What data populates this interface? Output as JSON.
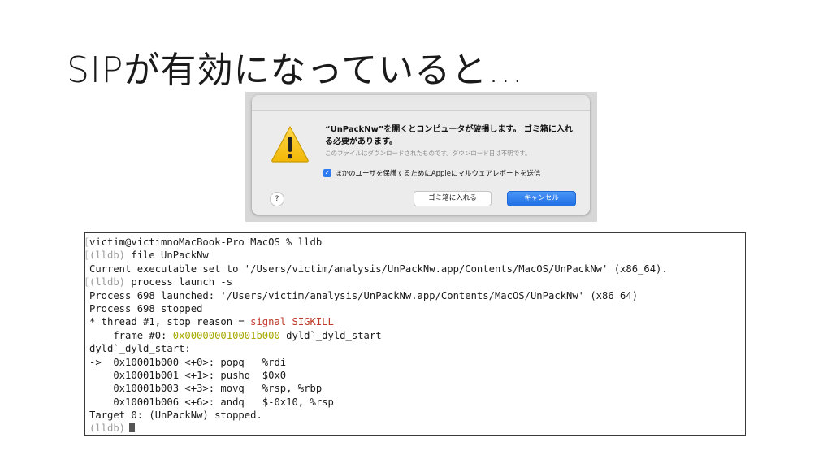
{
  "slide": {
    "title": "SIPが有効になっていると…"
  },
  "dialog": {
    "message": "“UnPackNw”を開くとコンピュータが破損します。 ゴミ箱に入れる必要があります。",
    "info": "このファイルはダウンロードされたものです。ダウンロード日は不明です。",
    "checkbox_label": "ほかのユーザを保護するためにAppleにマルウェアレポートを送信",
    "checkbox_checked": true,
    "help_label": "?",
    "trash_button": "ゴミ箱に入れる",
    "cancel_button": "キャンセル",
    "warning_icon": "warning-triangle-icon",
    "accent_color": "#2d7bf0"
  },
  "terminal": {
    "colors": {
      "signal": "#c0392b",
      "address": "#a8a800",
      "prompt": "#9a9a9a"
    },
    "lines": [
      {
        "bracket": "[",
        "segments": [
          {
            "text": "victim@victimnoMacBook-Pro MacOS % lldb",
            "style": "normal"
          }
        ]
      },
      {
        "bracket": "[",
        "segments": [
          {
            "text": "(lldb)",
            "style": "dim"
          },
          {
            "text": " file UnPackNw",
            "style": "normal"
          }
        ]
      },
      {
        "bracket": "",
        "segments": [
          {
            "text": "Current executable set to '/Users/victim/analysis/UnPackNw.app/Contents/MacOS/UnPackNw' (x86_64).",
            "style": "normal"
          }
        ]
      },
      {
        "bracket": "[",
        "segments": [
          {
            "text": "(lldb)",
            "style": "dim"
          },
          {
            "text": " process launch -s",
            "style": "normal"
          }
        ]
      },
      {
        "bracket": "",
        "segments": [
          {
            "text": "Process 698 launched: '/Users/victim/analysis/UnPackNw.app/Contents/MacOS/UnPackNw' (x86_64)",
            "style": "normal"
          }
        ]
      },
      {
        "bracket": "",
        "segments": [
          {
            "text": "Process 698 stopped",
            "style": "normal"
          }
        ]
      },
      {
        "bracket": "",
        "segments": [
          {
            "text": "* thread #1, stop reason = ",
            "style": "normal"
          },
          {
            "text": "signal SIGKILL",
            "style": "red"
          }
        ]
      },
      {
        "bracket": "",
        "segments": [
          {
            "text": "    frame #0: ",
            "style": "normal"
          },
          {
            "text": "0x000000010001b000",
            "style": "yellow"
          },
          {
            "text": " dyld`_dyld_start",
            "style": "normal"
          }
        ]
      },
      {
        "bracket": "",
        "segments": [
          {
            "text": "dyld`_dyld_start:",
            "style": "normal"
          }
        ]
      },
      {
        "bracket": "",
        "segments": [
          {
            "text": "->  0x10001b000 <+0>: popq   %rdi",
            "style": "normal"
          }
        ]
      },
      {
        "bracket": "",
        "segments": [
          {
            "text": "    0x10001b001 <+1>: pushq  $0x0",
            "style": "normal"
          }
        ]
      },
      {
        "bracket": "",
        "segments": [
          {
            "text": "    0x10001b003 <+3>: movq   %rsp, %rbp",
            "style": "normal"
          }
        ]
      },
      {
        "bracket": "",
        "segments": [
          {
            "text": "    0x10001b006 <+6>: andq   $-0x10, %rsp",
            "style": "normal"
          }
        ]
      },
      {
        "bracket": "",
        "segments": [
          {
            "text": "Target 0: (UnPackNw) stopped.",
            "style": "normal"
          }
        ]
      },
      {
        "bracket": "",
        "segments": [
          {
            "text": "(lldb)",
            "style": "dim"
          }
        ],
        "cursor": true
      }
    ]
  }
}
